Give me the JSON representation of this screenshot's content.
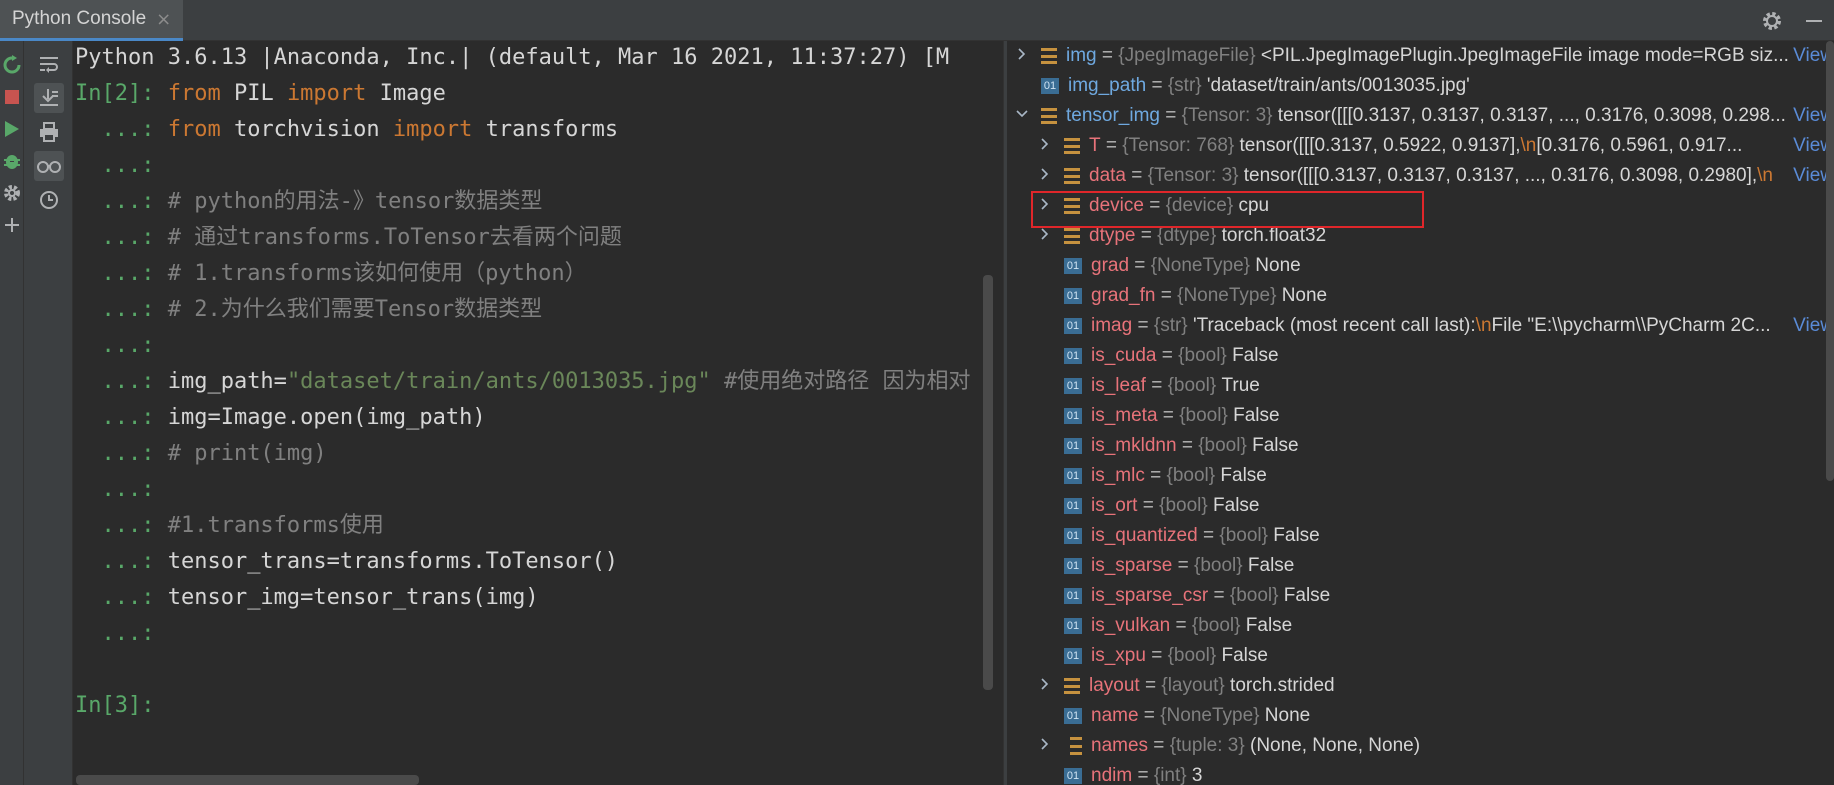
{
  "tab": {
    "title": "Python Console",
    "close": "×"
  },
  "console": {
    "banner": "Python 3.6.13 |Anaconda, Inc.| (default, Mar 16 2021, 11:37:27) [M",
    "lines": [
      {
        "prompt": "In[2]: ",
        "parts": [
          [
            "kw",
            "from"
          ],
          [
            "tx",
            " PIL "
          ],
          [
            "kw",
            "import"
          ],
          [
            "tx",
            " Image"
          ]
        ]
      },
      {
        "prompt": "  ...: ",
        "parts": [
          [
            "kw",
            "from"
          ],
          [
            "tx",
            " torchvision "
          ],
          [
            "kw",
            "import"
          ],
          [
            "tx",
            " transforms"
          ]
        ]
      },
      {
        "prompt": "  ...: ",
        "parts": []
      },
      {
        "prompt": "  ...: ",
        "parts": [
          [
            "cm",
            "# python的用法-》tensor数据类型"
          ]
        ]
      },
      {
        "prompt": "  ...: ",
        "parts": [
          [
            "cm",
            "# 通过transforms.ToTensor去看两个问题"
          ]
        ]
      },
      {
        "prompt": "  ...: ",
        "parts": [
          [
            "cm",
            "# 1.transforms该如何使用（python）"
          ]
        ]
      },
      {
        "prompt": "  ...: ",
        "parts": [
          [
            "cm",
            "# 2.为什么我们需要Tensor数据类型"
          ]
        ]
      },
      {
        "prompt": "  ...: ",
        "parts": []
      },
      {
        "prompt": "  ...: ",
        "parts": [
          [
            "tx",
            "img_path="
          ],
          [
            "st",
            "\"dataset/train/ants/0013035.jpg\""
          ],
          [
            "cm",
            " #使用绝对路径 因为相对"
          ]
        ]
      },
      {
        "prompt": "  ...: ",
        "parts": [
          [
            "tx",
            "img=Image.open(img_path)"
          ]
        ]
      },
      {
        "prompt": "  ...: ",
        "parts": [
          [
            "cm",
            "# print(img)"
          ]
        ]
      },
      {
        "prompt": "  ...: ",
        "parts": []
      },
      {
        "prompt": "  ...: ",
        "parts": [
          [
            "cm",
            "#1.transforms使用"
          ]
        ]
      },
      {
        "prompt": "  ...: ",
        "parts": [
          [
            "tx",
            "tensor_trans=transforms.ToTensor()"
          ]
        ]
      },
      {
        "prompt": "  ...: ",
        "parts": [
          [
            "tx",
            "tensor_img=tensor_trans(img)"
          ]
        ]
      },
      {
        "prompt": "  ...: ",
        "parts": []
      }
    ],
    "next_prompt": "In[3]:"
  },
  "variables": [
    {
      "chevron": ">",
      "icon": "obj",
      "top": true,
      "name": "img",
      "type": "{JpegImageFile}",
      "value": "<PIL.JpegImagePlugin.JpegImageFile image mode=RGB siz...",
      "view": "View"
    },
    {
      "chevron": "",
      "icon": "01",
      "top": true,
      "name": "img_path",
      "type": "{str}",
      "value": "'dataset/train/ants/0013035.jpg'"
    },
    {
      "chevron": "v",
      "icon": "obj",
      "top": true,
      "name": "tensor_img",
      "type": "{Tensor: 3}",
      "value": "tensor([[[0.3137, 0.3137, 0.3137,  ..., 0.3176, 0.3098, 0.298...",
      "view": "View"
    },
    {
      "chevron": ">",
      "icon": "obj",
      "indent": true,
      "name": "T",
      "type": "{Tensor: 768}",
      "value": "tensor([[[0.3137, 0.5922, 0.9137],",
      "nl": "\\n",
      "value2": "         [0.3176, 0.5961, 0.917...",
      "view": "View"
    },
    {
      "chevron": ">",
      "icon": "obj",
      "indent": true,
      "name": "data",
      "type": "{Tensor: 3}",
      "value": "tensor([[[0.3137, 0.3137, 0.3137,  ..., 0.3176, 0.3098, 0.2980],",
      "nl": "\\n",
      "view": "View"
    },
    {
      "chevron": ">",
      "icon": "obj",
      "indent": true,
      "name": "device",
      "type": "{device}",
      "value": "cpu"
    },
    {
      "chevron": ">",
      "icon": "obj",
      "indent": true,
      "name": "dtype",
      "type": "{dtype}",
      "value": "torch.float32"
    },
    {
      "chevron": "",
      "icon": "01",
      "indent": true,
      "name": "grad",
      "type": "{NoneType}",
      "value": "None"
    },
    {
      "chevron": "",
      "icon": "01",
      "indent": true,
      "name": "grad_fn",
      "type": "{NoneType}",
      "value": "None"
    },
    {
      "chevron": "",
      "icon": "01",
      "indent": true,
      "name": "imag",
      "type": "{str}",
      "value": "'Traceback (most recent call last):",
      "nl": "\\n",
      "value2": "  File \"E:\\\\pycharm\\\\PyCharm 2C...",
      "view": "View"
    },
    {
      "chevron": "",
      "icon": "01",
      "indent": true,
      "name": "is_cuda",
      "type": "{bool}",
      "value": "False"
    },
    {
      "chevron": "",
      "icon": "01",
      "indent": true,
      "name": "is_leaf",
      "type": "{bool}",
      "value": "True"
    },
    {
      "chevron": "",
      "icon": "01",
      "indent": true,
      "name": "is_meta",
      "type": "{bool}",
      "value": "False"
    },
    {
      "chevron": "",
      "icon": "01",
      "indent": true,
      "name": "is_mkldnn",
      "type": "{bool}",
      "value": "False"
    },
    {
      "chevron": "",
      "icon": "01",
      "indent": true,
      "name": "is_mlc",
      "type": "{bool}",
      "value": "False"
    },
    {
      "chevron": "",
      "icon": "01",
      "indent": true,
      "name": "is_ort",
      "type": "{bool}",
      "value": "False"
    },
    {
      "chevron": "",
      "icon": "01",
      "indent": true,
      "name": "is_quantized",
      "type": "{bool}",
      "value": "False"
    },
    {
      "chevron": "",
      "icon": "01",
      "indent": true,
      "name": "is_sparse",
      "type": "{bool}",
      "value": "False"
    },
    {
      "chevron": "",
      "icon": "01",
      "indent": true,
      "name": "is_sparse_csr",
      "type": "{bool}",
      "value": "False"
    },
    {
      "chevron": "",
      "icon": "01",
      "indent": true,
      "name": "is_vulkan",
      "type": "{bool}",
      "value": "False"
    },
    {
      "chevron": "",
      "icon": "01",
      "indent": true,
      "name": "is_xpu",
      "type": "{bool}",
      "value": "False"
    },
    {
      "chevron": ">",
      "icon": "obj",
      "indent": true,
      "name": "layout",
      "type": "{layout}",
      "value": "torch.strided"
    },
    {
      "chevron": "",
      "icon": "01",
      "indent": true,
      "name": "name",
      "type": "{NoneType}",
      "value": "None"
    },
    {
      "chevron": ">",
      "icon": "list",
      "indent": true,
      "name": "names",
      "type": "{tuple: 3}",
      "value": "(None, None, None)"
    },
    {
      "chevron": "",
      "icon": "01",
      "indent": true,
      "name": "ndim",
      "type": "{int}",
      "value": "3"
    }
  ],
  "icons": {
    "settings": "gear-icon",
    "minimize": "minimize-icon",
    "rerun": "rerun-icon",
    "stop": "stop-icon",
    "run": "run-icon",
    "debug": "bug-icon",
    "config": "gear-icon",
    "add": "plus-icon",
    "soft_wrap": "soft-wrap-icon",
    "scroll_to_end": "scroll-to-end-icon",
    "print": "print-icon",
    "show_variables": "glasses-icon",
    "history": "history-icon"
  },
  "colors": {
    "prompt": "#59a869",
    "keyword": "#cc7832",
    "string": "#6a8759",
    "comment": "#808080",
    "var_name": "#e8737a",
    "top_var_name": "#6fa9e0",
    "view_link": "#5a8bd6",
    "highlight_box": "#e0262a"
  }
}
